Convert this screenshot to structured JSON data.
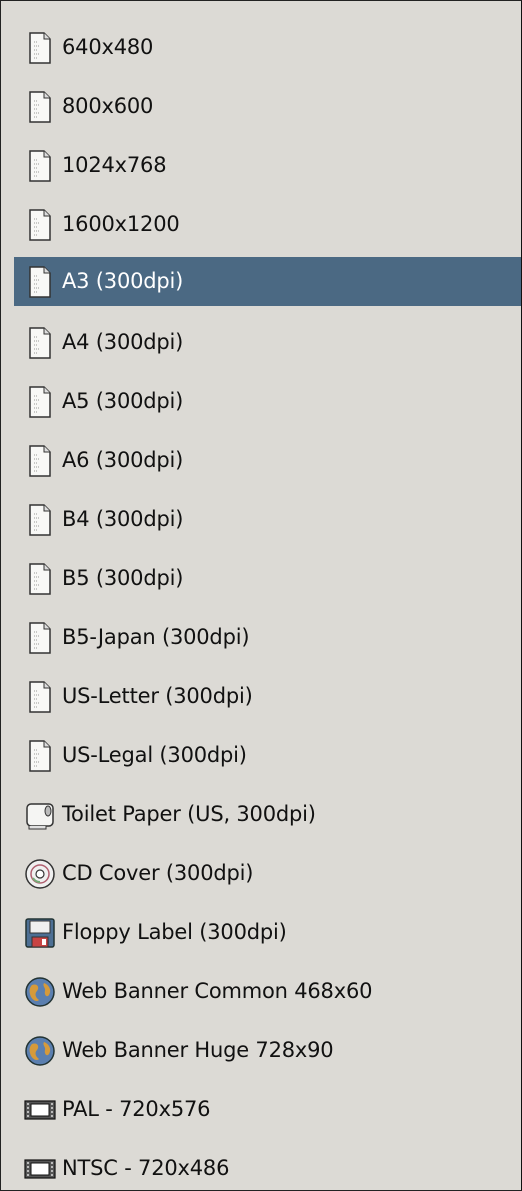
{
  "menu": {
    "items": [
      {
        "label": "640x480",
        "icon": "page-icon",
        "selected": false
      },
      {
        "label": "800x600",
        "icon": "page-icon",
        "selected": false
      },
      {
        "label": "1024x768",
        "icon": "page-icon",
        "selected": false
      },
      {
        "label": "1600x1200",
        "icon": "page-icon",
        "selected": false
      },
      {
        "label": "A3 (300dpi)",
        "icon": "page-icon",
        "selected": true
      },
      {
        "label": "A4 (300dpi)",
        "icon": "page-icon",
        "selected": false
      },
      {
        "label": "A5 (300dpi)",
        "icon": "page-icon",
        "selected": false
      },
      {
        "label": "A6 (300dpi)",
        "icon": "page-icon",
        "selected": false
      },
      {
        "label": "B4 (300dpi)",
        "icon": "page-icon",
        "selected": false
      },
      {
        "label": "B5 (300dpi)",
        "icon": "page-icon",
        "selected": false
      },
      {
        "label": "B5-Japan (300dpi)",
        "icon": "page-icon",
        "selected": false
      },
      {
        "label": "US-Letter (300dpi)",
        "icon": "page-icon",
        "selected": false
      },
      {
        "label": "US-Legal (300dpi)",
        "icon": "page-icon",
        "selected": false
      },
      {
        "label": "Toilet Paper (US, 300dpi)",
        "icon": "toilet-paper-icon",
        "selected": false
      },
      {
        "label": "CD Cover (300dpi)",
        "icon": "cd-icon",
        "selected": false
      },
      {
        "label": "Floppy Label (300dpi)",
        "icon": "floppy-icon",
        "selected": false
      },
      {
        "label": "Web Banner Common 468x60",
        "icon": "globe-icon",
        "selected": false
      },
      {
        "label": "Web Banner Huge 728x90",
        "icon": "globe-icon",
        "selected": false
      },
      {
        "label": "PAL - 720x576",
        "icon": "film-icon",
        "selected": false
      },
      {
        "label": "NTSC - 720x486",
        "icon": "film-icon",
        "selected": false
      }
    ]
  },
  "colors": {
    "background": "#dcdad5",
    "selected_background": "#4b6983",
    "selected_text": "#ffffff",
    "text": "#111111"
  }
}
